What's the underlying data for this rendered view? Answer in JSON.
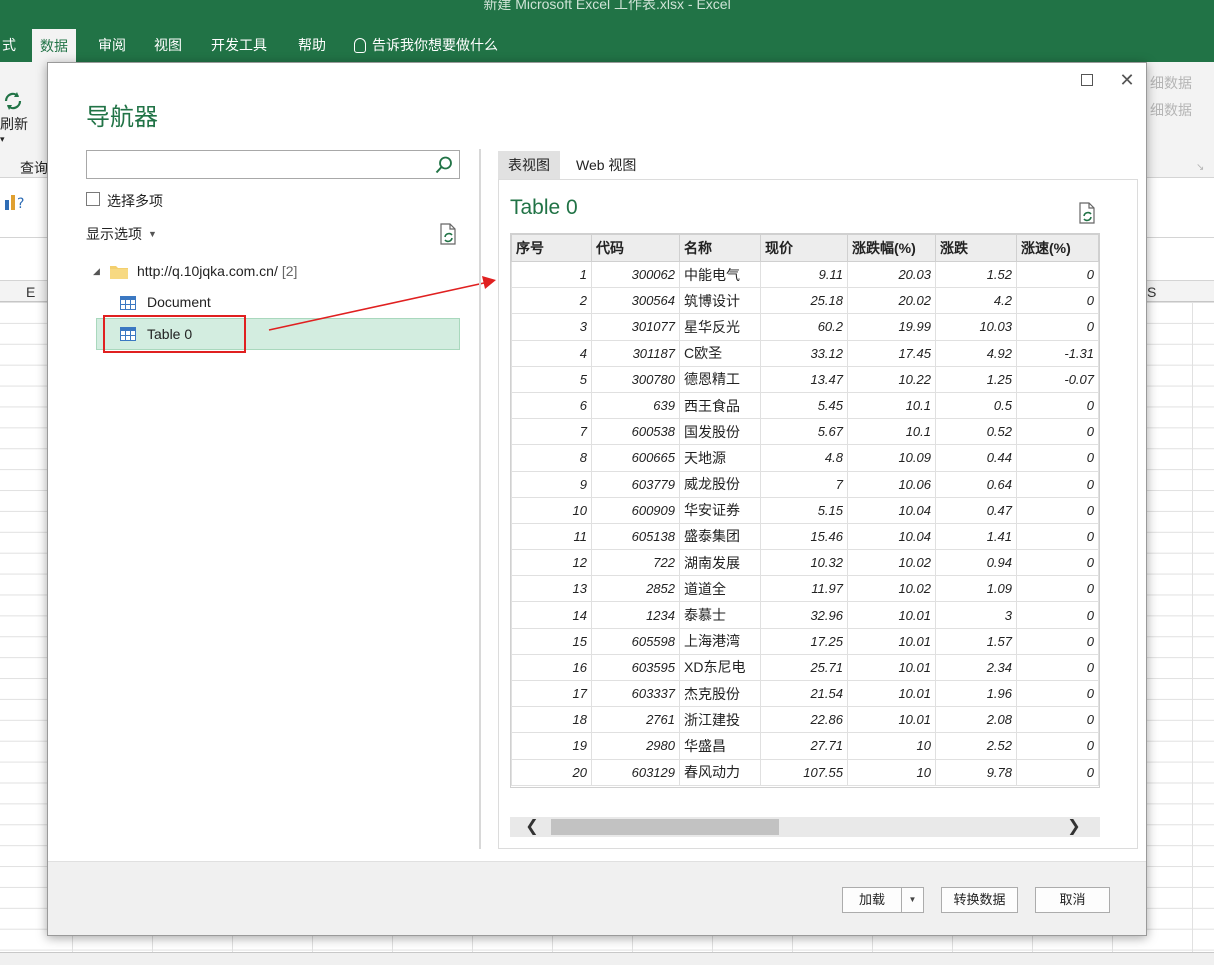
{
  "excel": {
    "window_title": "新建 Microsoft Excel 工作表.xlsx  -  Excel",
    "tabs": [
      {
        "label": "式",
        "active": false
      },
      {
        "label": "数据",
        "active": true
      },
      {
        "label": "审阅",
        "active": false
      },
      {
        "label": "视图",
        "active": false
      },
      {
        "label": "开发工具",
        "active": false
      },
      {
        "label": "帮助",
        "active": false
      }
    ],
    "tell_me": "告诉我你想要做什么",
    "ribbon": {
      "refresh_label": "刷新",
      "query_group": "查询",
      "detail_1": "细数据",
      "detail_2": "细数据"
    },
    "col_e": "E",
    "col_s": "S"
  },
  "dialog": {
    "title": "导航器",
    "search": {
      "value": "",
      "placeholder": ""
    },
    "select_multiple": "选择多项",
    "display_options": "显示选项",
    "tree": {
      "root": "http://q.10jqka.com.cn/",
      "root_count": "[2]",
      "items": [
        "Document",
        "Table 0"
      ]
    },
    "preview_tabs": [
      "表视图",
      "Web 视图"
    ],
    "preview_title": "Table 0",
    "columns": [
      "序号",
      "代码",
      "名称",
      "现价",
      "涨跌幅(%)",
      "涨跌",
      "涨速(%)"
    ],
    "rows": [
      [
        "1",
        "300062",
        "中能电气",
        "9.11",
        "20.03",
        "1.52",
        "0"
      ],
      [
        "2",
        "300564",
        "筑博设计",
        "25.18",
        "20.02",
        "4.2",
        "0"
      ],
      [
        "3",
        "301077",
        "星华反光",
        "60.2",
        "19.99",
        "10.03",
        "0"
      ],
      [
        "4",
        "301187",
        "C欧圣",
        "33.12",
        "17.45",
        "4.92",
        "-1.31"
      ],
      [
        "5",
        "300780",
        "德恩精工",
        "13.47",
        "10.22",
        "1.25",
        "-0.07"
      ],
      [
        "6",
        "639",
        "西王食品",
        "5.45",
        "10.1",
        "0.5",
        "0"
      ],
      [
        "7",
        "600538",
        "国发股份",
        "5.67",
        "10.1",
        "0.52",
        "0"
      ],
      [
        "8",
        "600665",
        "天地源",
        "4.8",
        "10.09",
        "0.44",
        "0"
      ],
      [
        "9",
        "603779",
        "威龙股份",
        "7",
        "10.06",
        "0.64",
        "0"
      ],
      [
        "10",
        "600909",
        "华安证券",
        "5.15",
        "10.04",
        "0.47",
        "0"
      ],
      [
        "11",
        "605138",
        "盛泰集团",
        "15.46",
        "10.04",
        "1.41",
        "0"
      ],
      [
        "12",
        "722",
        "湖南发展",
        "10.32",
        "10.02",
        "0.94",
        "0"
      ],
      [
        "13",
        "2852",
        "道道全",
        "11.97",
        "10.02",
        "1.09",
        "0"
      ],
      [
        "14",
        "1234",
        "泰慕士",
        "32.96",
        "10.01",
        "3",
        "0"
      ],
      [
        "15",
        "605598",
        "上海港湾",
        "17.25",
        "10.01",
        "1.57",
        "0"
      ],
      [
        "16",
        "603595",
        "XD东尼电",
        "25.71",
        "10.01",
        "2.34",
        "0"
      ],
      [
        "17",
        "603337",
        "杰克股份",
        "21.54",
        "10.01",
        "1.96",
        "0"
      ],
      [
        "18",
        "2761",
        "浙江建投",
        "22.86",
        "10.01",
        "2.08",
        "0"
      ],
      [
        "19",
        "2980",
        "华盛昌",
        "27.71",
        "10",
        "2.52",
        "0"
      ],
      [
        "20",
        "603129",
        "春风动力",
        "107.55",
        "10",
        "9.78",
        "0"
      ]
    ],
    "buttons": {
      "load": "加载",
      "transform": "转换数据",
      "cancel": "取消"
    },
    "colors": {
      "accent": "#217346",
      "selection": "#d3ede0",
      "highlight_box": "#e02020"
    }
  }
}
